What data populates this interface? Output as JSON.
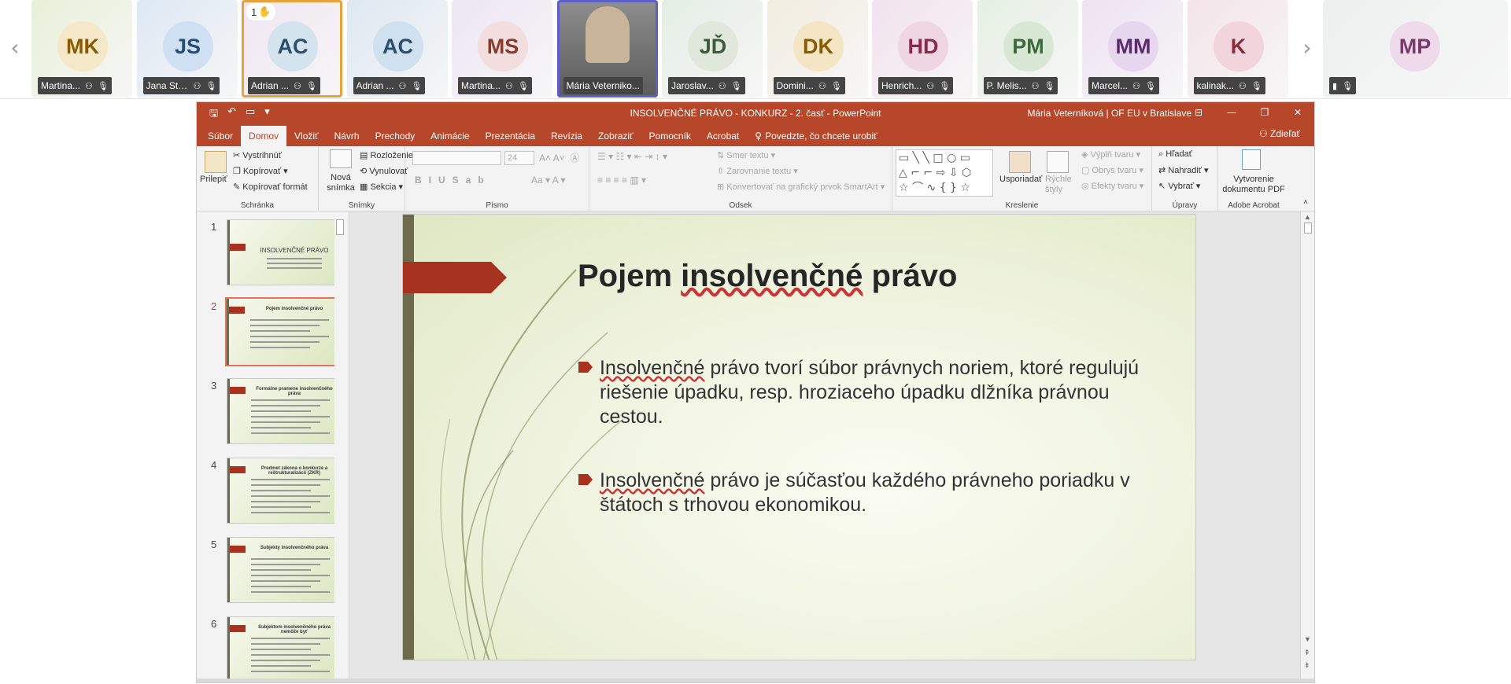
{
  "meeting": {
    "participants": [
      {
        "initials": "MK",
        "name": "Martina...",
        "bg": "#e9f0d8",
        "fg": "#8a5a00",
        "avatar_bg": "#f4e8c8"
      },
      {
        "initials": "JS",
        "name": "Jana Str...",
        "bg": "#dde8f4",
        "fg": "#264d7a",
        "avatar_bg": "#cfe0f2"
      },
      {
        "initials": "AC",
        "name": "Adrian ...",
        "bg": "#f0e6f2",
        "fg": "#2d4d6e",
        "avatar_bg": "#d4e4ee",
        "raised_hand": "1"
      },
      {
        "initials": "AC",
        "name": "Adrian ...",
        "bg": "#dde8f2",
        "fg": "#2d4d6e",
        "avatar_bg": "#cfe0ee"
      },
      {
        "initials": "MS",
        "name": "Martina...",
        "bg": "#ede6f4",
        "fg": "#8a3a2a",
        "avatar_bg": "#f2dede"
      },
      {
        "initials": "",
        "name": "Mária Veterniko...",
        "bg": "#8c8c8c",
        "fg": "#fff",
        "avatar_bg": "#c9b59a",
        "video": true
      },
      {
        "initials": "JĎ",
        "name": "Jaroslav...",
        "bg": "#e4eee4",
        "fg": "#3d5a3d",
        "avatar_bg": "#dfe8da"
      },
      {
        "initials": "DK",
        "name": "Domini...",
        "bg": "#f2ede0",
        "fg": "#8a5a00",
        "avatar_bg": "#f4e6c4"
      },
      {
        "initials": "HD",
        "name": "Henrich...",
        "bg": "#f2e2ee",
        "fg": "#8a2a4a",
        "avatar_bg": "#f0d6e2"
      },
      {
        "initials": "PM",
        "name": "P. Melis...",
        "bg": "#e6f0e4",
        "fg": "#3d6a3d",
        "avatar_bg": "#d8e8d4"
      },
      {
        "initials": "MM",
        "name": "Marcel...",
        "bg": "#eee2f2",
        "fg": "#5a2a6a",
        "avatar_bg": "#e6d6ee"
      },
      {
        "initials": "K",
        "name": "kalinak...",
        "bg": "#f4e4ea",
        "fg": "#8a2a3a",
        "avatar_bg": "#f2d4dc"
      },
      {
        "initials": "MP",
        "name": "",
        "bg": "#eef0f0",
        "fg": "#7a3a6a",
        "avatar_bg": "#eedaea"
      }
    ],
    "prev_arrow": "‹",
    "next_arrow": "›"
  },
  "powerpoint": {
    "doc_title": "INSOLVENČNÉ PRÁVO - KONKURZ - 2. časť  -  PowerPoint",
    "user": "Mária Veterníková | OF EU v Bratislave",
    "tabs": [
      "Súbor",
      "Domov",
      "Vložiť",
      "Návrh",
      "Prechody",
      "Animácie",
      "Prezentácia",
      "Revízia",
      "Zobraziť",
      "Pomocník",
      "Acrobat"
    ],
    "selected_tab": "Domov",
    "tell_me": "Povedzte, čo chcete urobiť",
    "share": "Zdieľať",
    "ribbon": {
      "paste": "Prilepiť",
      "cut": "Vystrihnúť",
      "copy": "Kopírovať",
      "format_painter": "Kopírovať formát",
      "clipboard_group": "Schránka",
      "new_slide": "Nová snímka",
      "layout": "Rozloženie",
      "reset": "Vynulovať",
      "section": "Sekcia",
      "slides_group": "Snímky",
      "font_size": "24",
      "font_group": "Písmo",
      "text_direction": "Smer textu",
      "align_text": "Zarovnanie textu",
      "smartart": "Konvertovať na grafický prvok SmartArt",
      "paragraph_group": "Odsek",
      "arrange": "Usporiadať",
      "quick_styles": "Rýchle štýly",
      "shape_fill": "Výplň tvaru",
      "shape_outline": "Obrys tvaru",
      "shape_effects": "Efekty tvaru",
      "drawing_group": "Kreslenie",
      "find": "Hľadať",
      "replace": "Nahradiť",
      "select": "Vybrať",
      "editing_group": "Úpravy",
      "create_pdf": "Vytvorenie dokumentu PDF",
      "acrobat_group": "Adobe Acrobat"
    },
    "thumbnails": [
      {
        "num": "1",
        "title": "INSOLVENČNÉ PRÁVO"
      },
      {
        "num": "2",
        "title": "Pojem insolvenčné právo",
        "selected": true
      },
      {
        "num": "3",
        "title": "Formálne pramene insolvenčného práva"
      },
      {
        "num": "4",
        "title": "Predmet zákona o konkurze a reštrukturalizácii (ZKR)"
      },
      {
        "num": "5",
        "title": "Subjekty insolvenčného práva"
      },
      {
        "num": "6",
        "title": "Subjektom insolvenčného práva nemôže byť"
      }
    ],
    "slide": {
      "title_pre": "Pojem ",
      "title_u": "insolvenčné",
      "title_post": " právo",
      "bullet1_u": "Insolvenčné",
      "bullet1": " právo tvorí súbor právnych noriem, ktoré regulujú riešenie úpadku, resp. hroziaceho úpadku dlžníka právnou cestou.",
      "bullet2_u": "Insolvenčné",
      "bullet2": " právo je súčasťou každého právneho poriadku v štátoch s trhovou ekonomikou."
    },
    "colors": {
      "accent": "#b7472a",
      "arrow": "#a83220"
    }
  }
}
